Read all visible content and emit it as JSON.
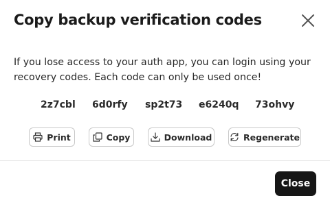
{
  "dialog": {
    "title": "Copy backup verification codes",
    "description": "If you lose access to your auth app, you can login using your recovery codes. Each code can only be used once!",
    "codes": [
      "2z7cbl",
      "6d0rfy",
      "sp2t73",
      "e6240q",
      "73ohvy"
    ],
    "actions": {
      "print": "Print",
      "copy": "Copy",
      "download": "Download",
      "regenerate": "Regenerate"
    },
    "close_label": "Close",
    "icons": {
      "close": "close-icon",
      "print": "printer-icon",
      "copy": "copy-icon",
      "download": "download-icon",
      "regenerate": "refresh-icon"
    },
    "colors": {
      "primary_button": "#161616",
      "border": "#c8c8c8"
    }
  }
}
